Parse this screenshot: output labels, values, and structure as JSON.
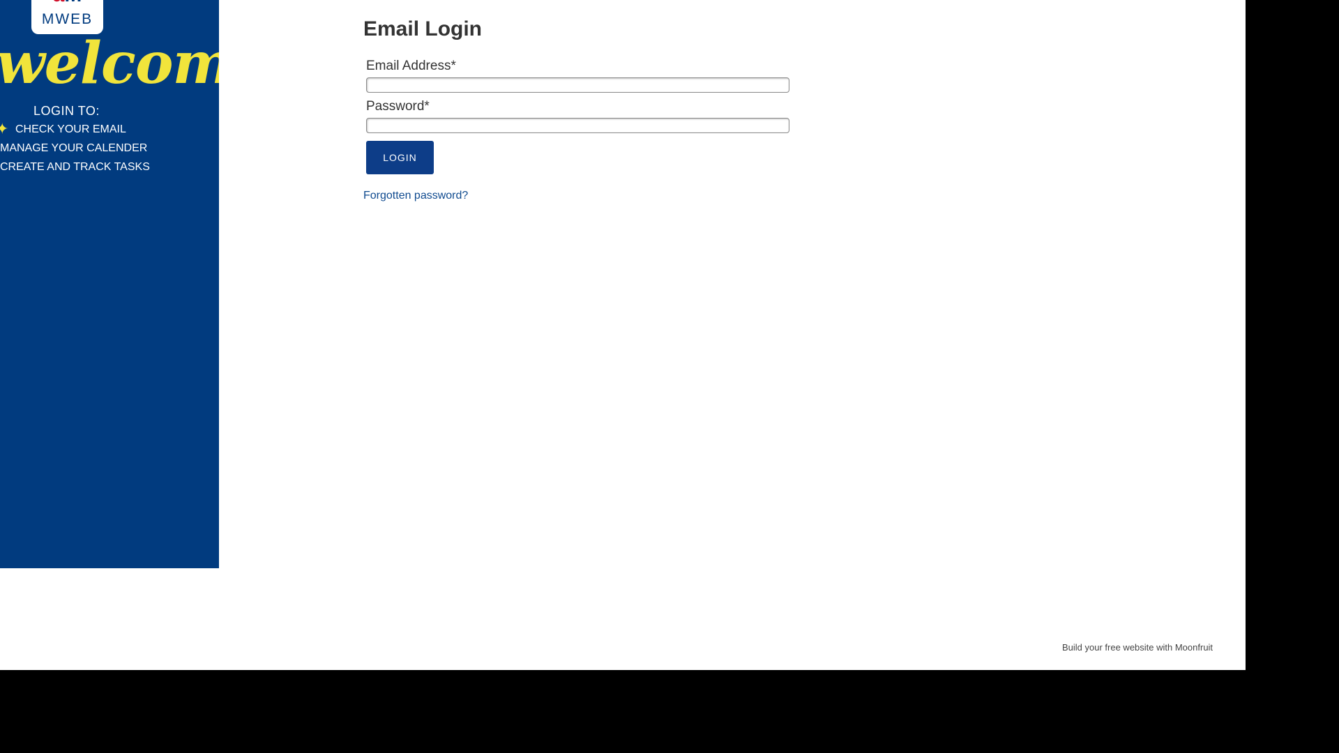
{
  "sidebar": {
    "logo_mark_a": "a",
    "logo_mark_m": "M",
    "logo_text": "MWEB",
    "welcome_text": "welcome",
    "login_to_heading": "LOGIN TO:",
    "features": [
      "CHECK YOUR EMAIL",
      "MANAGE YOUR CALENDER",
      "CREATE AND TRACK TASKS"
    ],
    "bullet_icon": "star-icon",
    "colors": {
      "background": "#013b7f",
      "welcome": "#f1e43b",
      "logo_accent": "#d0112b"
    }
  },
  "main": {
    "title": "Email Login",
    "email_label": "Email Address*",
    "email_value": "",
    "password_label": "Password*",
    "password_value": "",
    "login_button_label": "LOGIN",
    "forgot_password_link": "Forgotten password?",
    "colors": {
      "button": "#0d3d88",
      "link": "#0f4a8f"
    }
  },
  "footer": {
    "builder_link": "Build your free website with Moonfruit"
  }
}
